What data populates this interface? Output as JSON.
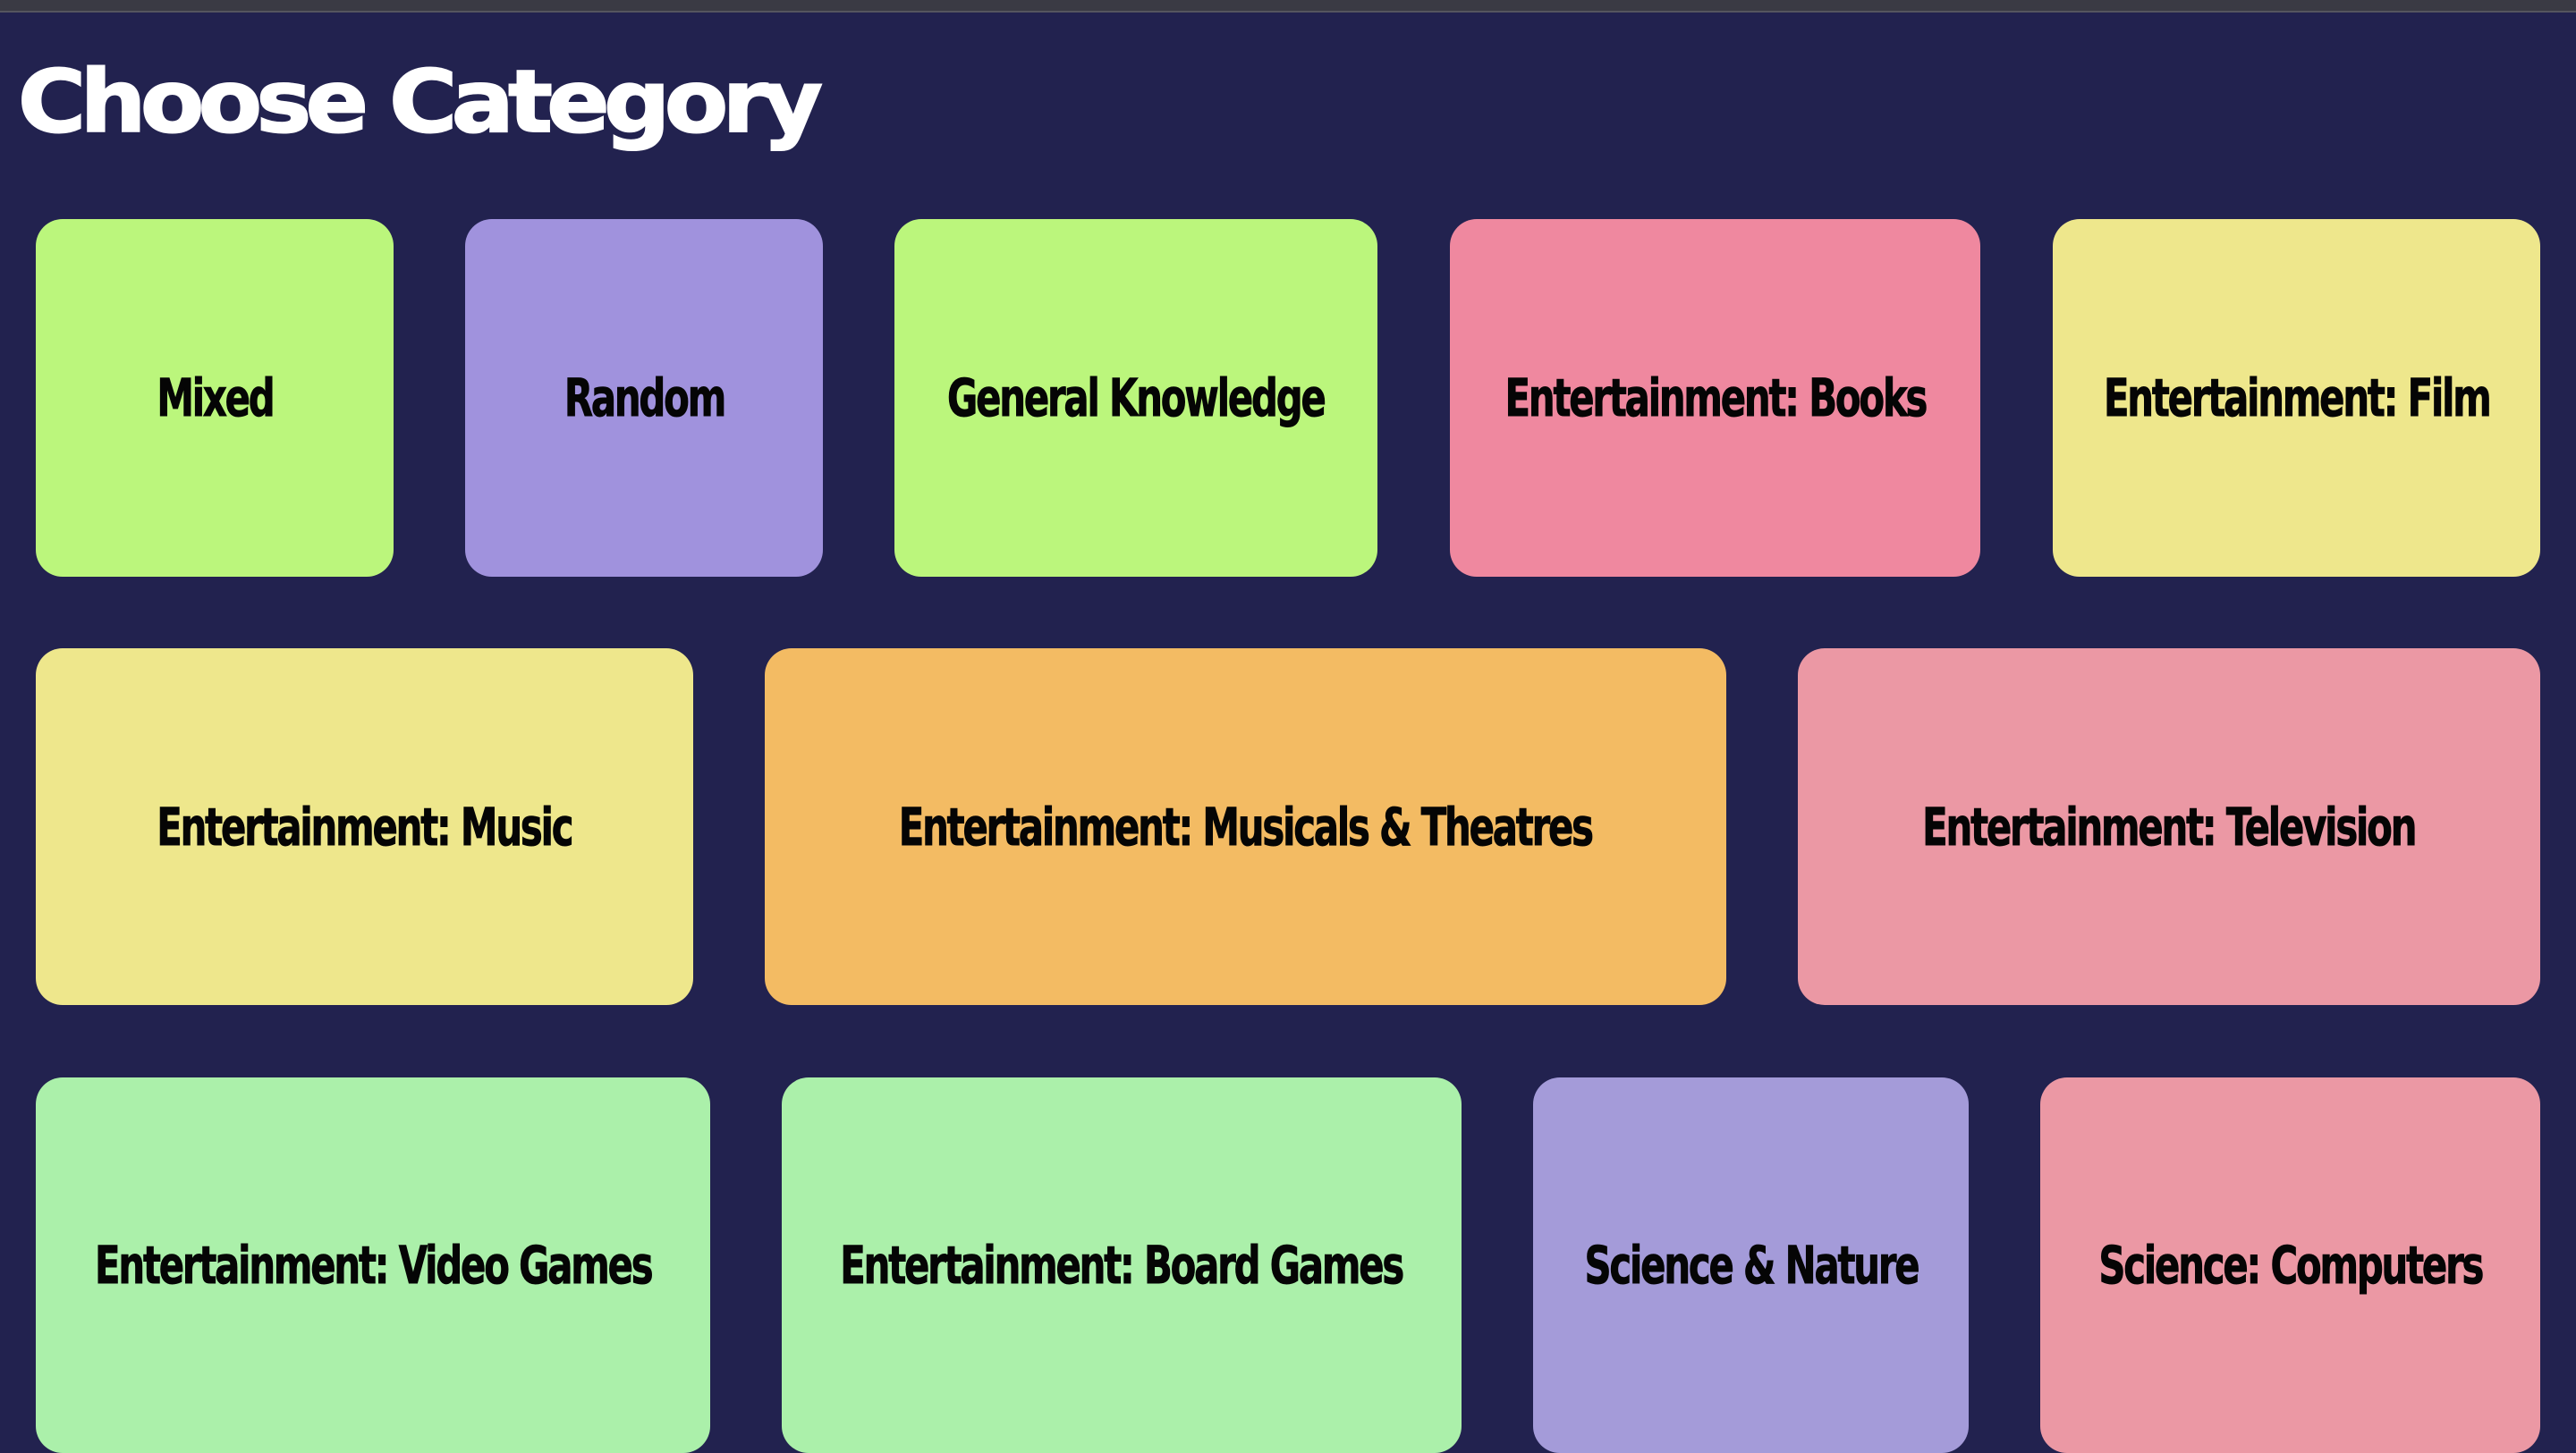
{
  "page": {
    "title": "Choose Category"
  },
  "colors": {
    "background": "#22224f",
    "green": "#bbf67c",
    "purple": "#a092dd",
    "pink": "#ef889f",
    "yellow": "#eee78c",
    "orange": "#f3bb63",
    "rose": "#eb98a4",
    "mint": "#abf0aa",
    "lavender": "#a49bd9"
  },
  "categories": [
    {
      "label": "Mixed",
      "color": "#bbf67c"
    },
    {
      "label": "Random",
      "color": "#a092dd"
    },
    {
      "label": "General Knowledge",
      "color": "#bbf67c"
    },
    {
      "label": "Entertainment: Books",
      "color": "#ef889f"
    },
    {
      "label": "Entertainment: Film",
      "color": "#eee78c"
    },
    {
      "label": "Entertainment: Music",
      "color": "#eee78c"
    },
    {
      "label": "Entertainment: Musicals & Theatres",
      "color": "#f3bb63"
    },
    {
      "label": "Entertainment: Television",
      "color": "#eb98a4"
    },
    {
      "label": "Entertainment: Video Games",
      "color": "#abf0aa"
    },
    {
      "label": "Entertainment: Board Games",
      "color": "#abf0aa"
    },
    {
      "label": "Science & Nature",
      "color": "#a49bd9"
    },
    {
      "label": "Science: Computers",
      "color": "#eb98a4"
    }
  ]
}
